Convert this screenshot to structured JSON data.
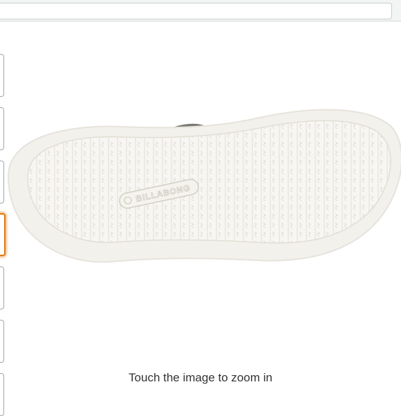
{
  "product_image": {
    "brand_text": "BILLABONG"
  },
  "thumbnails": {
    "count": 7,
    "selected_index": 3
  },
  "zoom_hint": "Touch the image to zoom in",
  "colors": {
    "selected_thumb_border": "#e77600",
    "sole": "#f5f4f0",
    "background": "#ffffff"
  }
}
